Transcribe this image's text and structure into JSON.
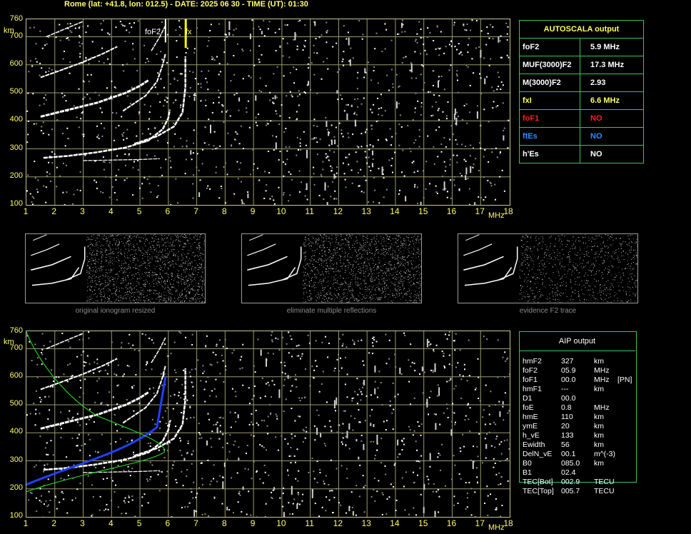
{
  "header": {
    "text": "Rome (lat: +41.8, lon: 012.5) - DATE: 2025 06 30 - TIME (UT): 01:30"
  },
  "ionogram": {
    "y_ticks": [
      "760",
      "700",
      "600",
      "500",
      "400",
      "300",
      "200",
      "100"
    ],
    "y_unit": "km",
    "x_ticks": [
      "1",
      "2",
      "3",
      "4",
      "5",
      "6",
      "7",
      "8",
      "9",
      "10",
      "11",
      "12",
      "13",
      "14",
      "15",
      "16",
      "17",
      "18"
    ],
    "x_unit": "MHz",
    "label_foF2": "foF2",
    "label_fx": "fx",
    "colors": {
      "axis": "#ffff66",
      "grid": "#9a9a70",
      "fx_marker": "#ffff00",
      "trace": "#ffffff",
      "aip_blue": "#2040ff",
      "aip_green": "#22cc22"
    }
  },
  "autoscala": {
    "title": "AUTOSCALA output",
    "rows": [
      {
        "name": "foF2",
        "value": "5.9 MHz",
        "color": "#ffffff"
      },
      {
        "name": "MUF(3000)F2",
        "value": "17.3 MHz",
        "color": "#ffffff"
      },
      {
        "name": "M(3000)F2",
        "value": "2.93",
        "color": "#ffffff"
      },
      {
        "name": "fxI",
        "value": "6.6 MHz",
        "color": "#ffff66"
      },
      {
        "name": "foF1",
        "value": "NO",
        "color": "#ff2020"
      },
      {
        "name": "ftEs",
        "value": "NO",
        "color": "#2f8cff"
      },
      {
        "name": "h'Es",
        "value": "NO",
        "color": "#ffffff"
      }
    ]
  },
  "thumbnails": [
    {
      "caption": "original ionogram resized"
    },
    {
      "caption": "eliminate multiple reflections"
    },
    {
      "caption": "evidence F2 trace"
    }
  ],
  "aip": {
    "title": "AIP output",
    "rows": [
      {
        "name": "hmF2",
        "value": "327",
        "unit": "km",
        "extra": ""
      },
      {
        "name": "foF2",
        "value": "05.9",
        "unit": "MHz",
        "extra": ""
      },
      {
        "name": "foF1",
        "value": "00.0",
        "unit": "MHz",
        "extra": "[PN]"
      },
      {
        "name": "hmF1",
        "value": "---",
        "unit": "km",
        "extra": ""
      },
      {
        "name": "D1",
        "value": "00.0",
        "unit": "",
        "extra": ""
      },
      {
        "name": "foE",
        "value": "0.8",
        "unit": "MHz",
        "extra": ""
      },
      {
        "name": "hmE",
        "value": "110",
        "unit": "km",
        "extra": ""
      },
      {
        "name": "ymE",
        "value": "20",
        "unit": "km",
        "extra": ""
      },
      {
        "name": "h_vE",
        "value": "133",
        "unit": "km",
        "extra": ""
      },
      {
        "name": "Ewidth",
        "value": "56",
        "unit": "km",
        "extra": ""
      },
      {
        "name": "DelN_vE",
        "value": "00.1",
        "unit": "m^(-3)",
        "extra": ""
      },
      {
        "name": "B0",
        "value": "085.0",
        "unit": "km",
        "extra": ""
      },
      {
        "name": "B1",
        "value": "02.4",
        "unit": "",
        "extra": ""
      },
      {
        "name": "TEC[Bot]",
        "value": "002.9",
        "unit": "TECU",
        "extra": ""
      },
      {
        "name": "TEC[Top]",
        "value": "005.7",
        "unit": "TECU",
        "extra": ""
      }
    ]
  }
}
